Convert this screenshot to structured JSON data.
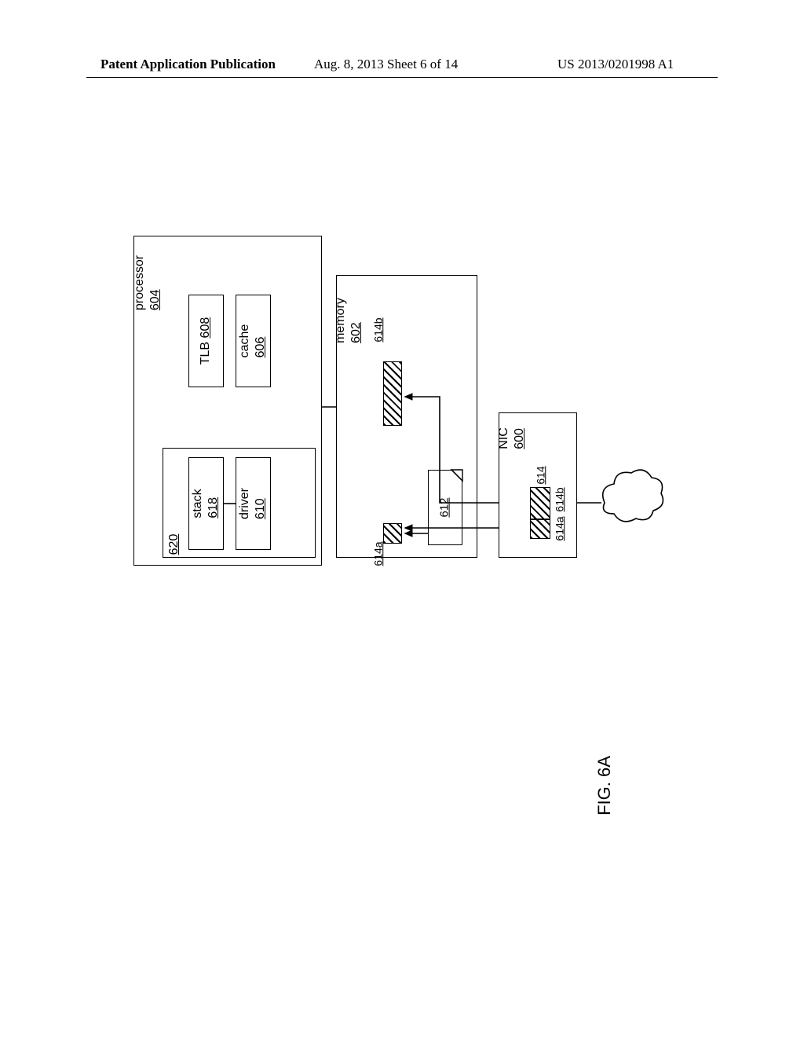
{
  "header": {
    "left": "Patent Application Publication",
    "mid": "Aug. 8, 2013  Sheet 6 of 14",
    "right": "US 2013/0201998 A1"
  },
  "figure_caption": "FIG. 6A",
  "processor": {
    "title": "processor",
    "ref": "604",
    "app_box_ref": "620",
    "stack_title": "stack",
    "stack_ref": "618",
    "driver_title": "driver",
    "driver_ref": "610",
    "tlb_title": "TLB",
    "tlb_ref": "608",
    "cache_title": "cache",
    "cache_ref": "606"
  },
  "memory": {
    "title": "memory",
    "ref": "602",
    "buf_a_ref": "614a",
    "buf_b_ref": "614b",
    "page_table_ref": "612"
  },
  "nic": {
    "title": "NIC",
    "ref": "600",
    "buf_ref": "614",
    "buf_a_ref": "614a",
    "buf_b_ref": "614b"
  }
}
